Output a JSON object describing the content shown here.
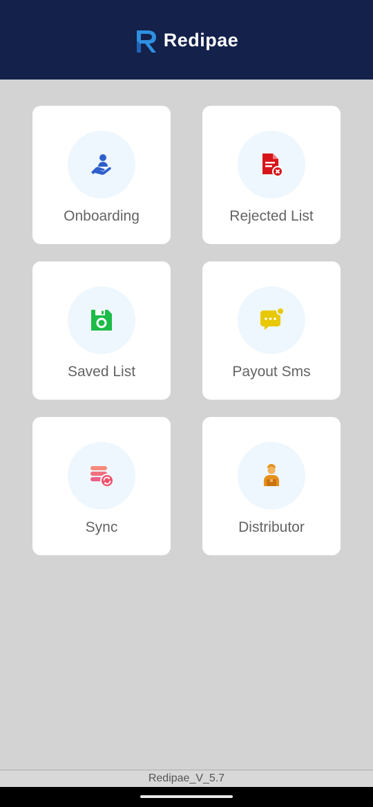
{
  "header": {
    "brand_name": "Redipae",
    "background_color": "#13214b",
    "logo_icon": "redipae-r-logo"
  },
  "tiles": [
    {
      "label": "Onboarding",
      "icon": "hand-user-icon",
      "icon_color": "#2f5fcb"
    },
    {
      "label": "Rejected List",
      "icon": "rejected-document-icon",
      "icon_color": "#d8141b"
    },
    {
      "label": "Saved List",
      "icon": "save-disk-icon",
      "icon_color": "#1dbb48"
    },
    {
      "label": "Payout Sms",
      "icon": "chat-message-icon",
      "icon_color": "#e8c800"
    },
    {
      "label": "Sync",
      "icon": "database-sync-icon",
      "icon_color": "#ef4f6b"
    },
    {
      "label": "Distributor",
      "icon": "distributor-person-icon",
      "icon_color": "#e5901b"
    }
  ],
  "footer": {
    "version": "Redipae_V_5.7"
  }
}
